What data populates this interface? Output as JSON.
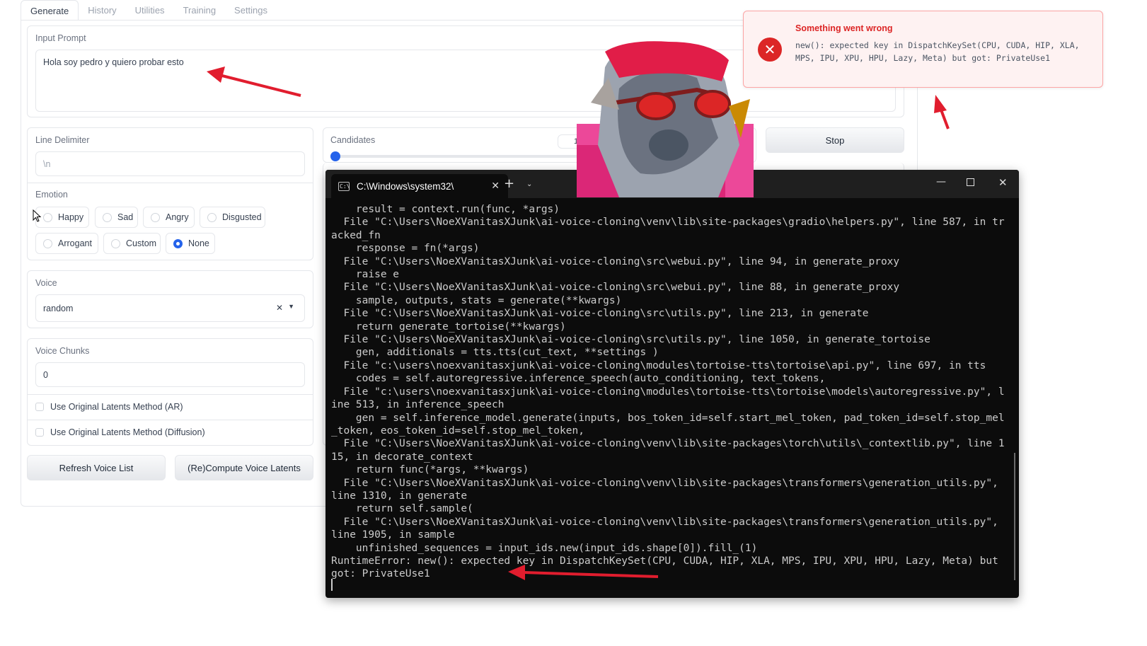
{
  "tabs": [
    "Generate",
    "History",
    "Utilities",
    "Training",
    "Settings"
  ],
  "input_prompt": {
    "label": "Input Prompt",
    "value": "Hola soy pedro y quiero probar esto"
  },
  "line_delimiter": {
    "label": "Line Delimiter",
    "placeholder": "\\n"
  },
  "emotion": {
    "label": "Emotion",
    "options": [
      "Happy",
      "Sad",
      "Angry",
      "Disgusted",
      "Arrogant",
      "Custom",
      "None"
    ],
    "selected": "None"
  },
  "voice": {
    "label": "Voice",
    "value": "random"
  },
  "voice_chunks": {
    "label": "Voice Chunks",
    "value": "0"
  },
  "checkboxes": {
    "ar": "Use Original Latents Method (AR)",
    "diffusion": "Use Original Latents Method (Diffusion)"
  },
  "buttons": {
    "refresh": "Refresh Voice List",
    "compute": "(Re)Compute Voice Latents",
    "stop": "Stop"
  },
  "candidates": {
    "label": "Candidates",
    "value": "1"
  },
  "error_toast": {
    "title": "Something went wrong",
    "message": "new(): expected key in DispatchKeySet(CPU, CUDA, HIP, XLA, MPS, IPU, XPU, HPU, Lazy, Meta) but got: PrivateUse1"
  },
  "terminal": {
    "tab_title": "C:\\Windows\\system32\\",
    "lines": [
      "    result = context.run(func, *args)",
      "  File \"C:\\Users\\NoeXVanitasXJunk\\ai-voice-cloning\\venv\\lib\\site-packages\\gradio\\helpers.py\", line 587, in tr",
      "acked_fn",
      "    response = fn(*args)",
      "  File \"C:\\Users\\NoeXVanitasXJunk\\ai-voice-cloning\\src\\webui.py\", line 94, in generate_proxy",
      "    raise e",
      "  File \"C:\\Users\\NoeXVanitasXJunk\\ai-voice-cloning\\src\\webui.py\", line 88, in generate_proxy",
      "    sample, outputs, stats = generate(**kwargs)",
      "  File \"C:\\Users\\NoeXVanitasXJunk\\ai-voice-cloning\\src\\utils.py\", line 213, in generate",
      "    return generate_tortoise(**kwargs)",
      "  File \"C:\\Users\\NoeXVanitasXJunk\\ai-voice-cloning\\src\\utils.py\", line 1050, in generate_tortoise",
      "    gen, additionals = tts.tts(cut_text, **settings )",
      "  File \"c:\\users\\noexvanitasxjunk\\ai-voice-cloning\\modules\\tortoise-tts\\tortoise\\api.py\", line 697, in tts",
      "    codes = self.autoregressive.inference_speech(auto_conditioning, text_tokens,",
      "  File \"c:\\users\\noexvanitasxjunk\\ai-voice-cloning\\modules\\tortoise-tts\\tortoise\\models\\autoregressive.py\", l",
      "ine 513, in inference_speech",
      "    gen = self.inference_model.generate(inputs, bos_token_id=self.start_mel_token, pad_token_id=self.stop_mel",
      "_token, eos_token_id=self.stop_mel_token,",
      "  File \"C:\\Users\\NoeXVanitasXJunk\\ai-voice-cloning\\venv\\lib\\site-packages\\torch\\utils\\_contextlib.py\", line 1",
      "15, in decorate_context",
      "    return func(*args, **kwargs)",
      "  File \"C:\\Users\\NoeXVanitasXJunk\\ai-voice-cloning\\venv\\lib\\site-packages\\transformers\\generation_utils.py\",",
      "line 1310, in generate",
      "    return self.sample(",
      "  File \"C:\\Users\\NoeXVanitasXJunk\\ai-voice-cloning\\venv\\lib\\site-packages\\transformers\\generation_utils.py\",",
      "line 1905, in sample",
      "    unfinished_sequences = input_ids.new(input_ids.shape[0]).fill_(1)",
      "RuntimeError: new(): expected key in DispatchKeySet(CPU, CUDA, HIP, XLA, MPS, IPU, XPU, HPU, Lazy, Meta) but",
      "got: PrivateUse1"
    ]
  },
  "colors": {
    "accent": "#2563eb",
    "error": "#dc2626",
    "arrow": "#e11d2e",
    "terminal_bg": "#0c0c0c"
  }
}
